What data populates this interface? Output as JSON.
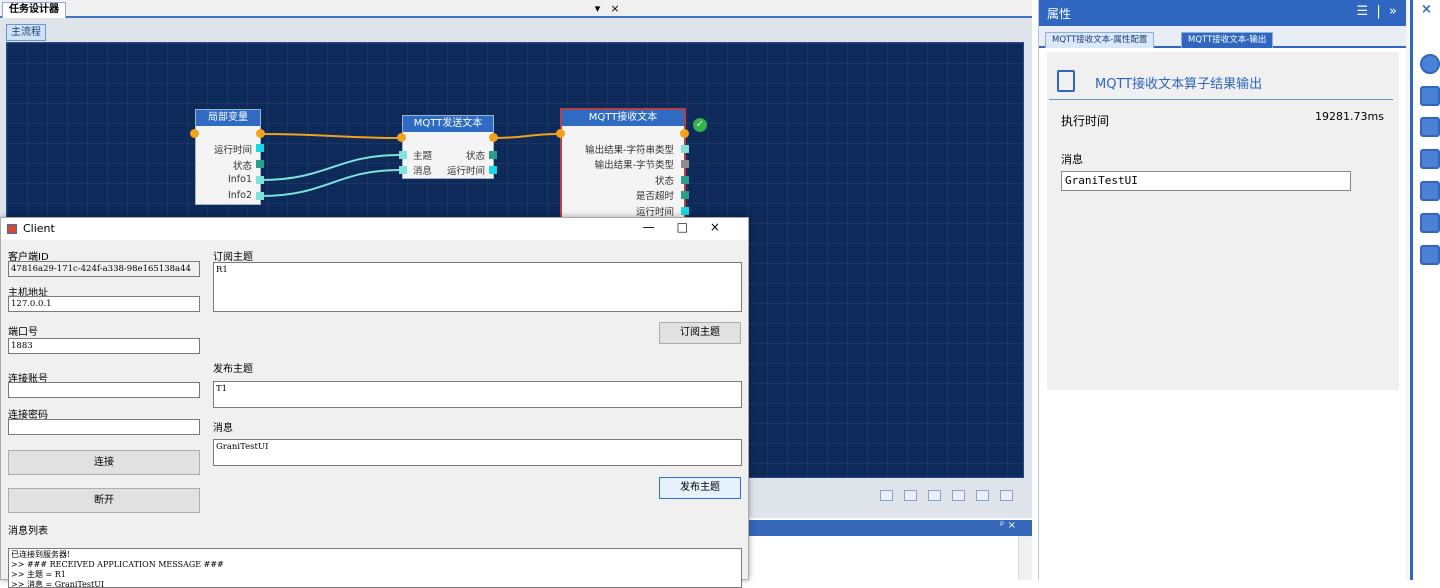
{
  "doc": {
    "tab_label": "任务设计器",
    "ctrl_pin": "▾",
    "ctrl_close": "×",
    "sub_tab": "主流程"
  },
  "nodes": {
    "local_var": {
      "title": "局部变量",
      "rows": [
        "运行时间",
        "状态",
        "Info1",
        "Info2"
      ]
    },
    "mqtt_send": {
      "title": "MQTT发送文本",
      "inputs": [
        "主题",
        "消息"
      ],
      "outputs": [
        "状态",
        "运行时间"
      ]
    },
    "mqtt_recv": {
      "title": "MQTT接收文本",
      "rows": [
        "输出结果-字符串类型",
        "输出结果-字节类型",
        "状态",
        "是否超时",
        "运行时间"
      ]
    }
  },
  "properties": {
    "panel_title": "属性",
    "tabs": [
      "MQTT接收文本-属性配置",
      "MQTT接收文本-输出"
    ],
    "section_title": "MQTT接收文本算子结果输出",
    "exec_label": "执行时间",
    "exec_value": "19281.73ms",
    "msg_label": "消息",
    "msg_value": "GraniTestUI"
  },
  "rail": {
    "close": "×"
  },
  "bottom": {
    "pin": "ᵖ ×"
  },
  "client": {
    "title": "Client",
    "controls": "—□×",
    "client_id_label": "客户端ID",
    "client_id": "47816a29-171c-424f-a338-98e165138a44",
    "host_label": "主机地址",
    "host": "127.0.0.1",
    "port_label": "端口号",
    "port": "1883",
    "user_label": "连接账号",
    "user": "",
    "pwd_label": "连接密码",
    "pwd": "",
    "connect_btn": "连接",
    "disconnect_btn": "断开",
    "sub_label": "订阅主题",
    "sub_value": "R1",
    "sub_btn": "订阅主题",
    "pub_label": "发布主题",
    "pub_value": "T1",
    "msg_label": "消息",
    "msg_value": "GraniTestUI",
    "pub_btn": "发布主题",
    "list_label": "消息列表",
    "list_lines": [
      "已连接到服务器!",
      ">> ### RECEIVED APPLICATION MESSAGE ###",
      ">> 主题 = R1",
      ">> 消息 = GraniTestUI"
    ]
  }
}
